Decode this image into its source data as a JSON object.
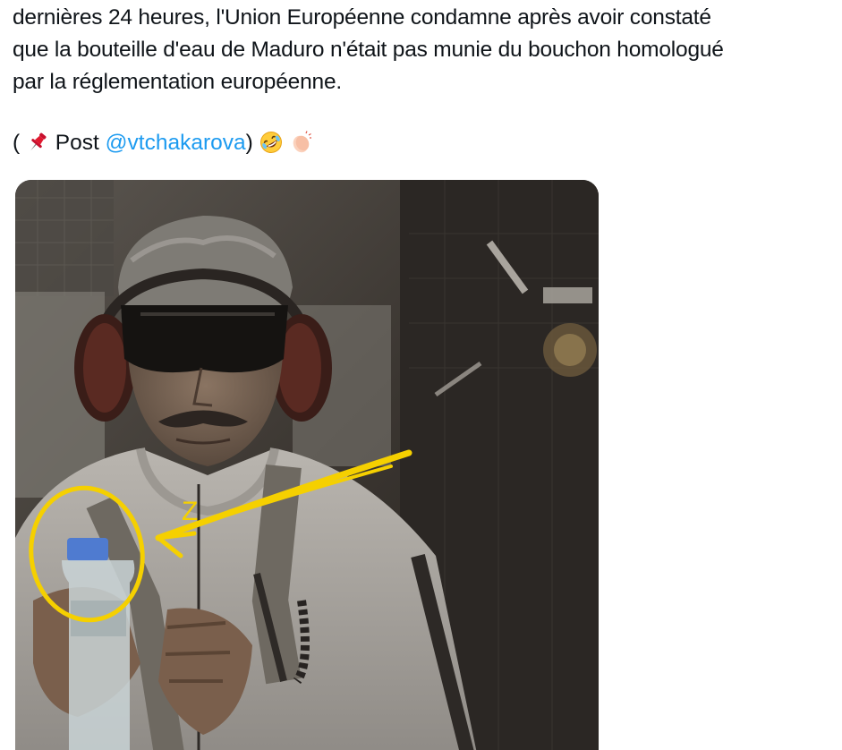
{
  "tweet": {
    "lines": [
      "dernières 24 heures, l'Union Européenne condamne après avoir constaté",
      "que la bouteille d'eau de Maduro n'était pas munie du bouchon homologué",
      "par la réglementation européenne."
    ],
    "credit": {
      "open_paren": "(",
      "pin_icon": "pushpin-icon",
      "post_label": "Post",
      "mention": "@vtchakarova",
      "close_paren": ")",
      "emoji_1": "rolling-on-floor-laughing-icon",
      "emoji_2": "clapping-hands-icon"
    }
  },
  "media": {
    "annotation_text": "Z",
    "annotation_color": "#f5d000"
  }
}
